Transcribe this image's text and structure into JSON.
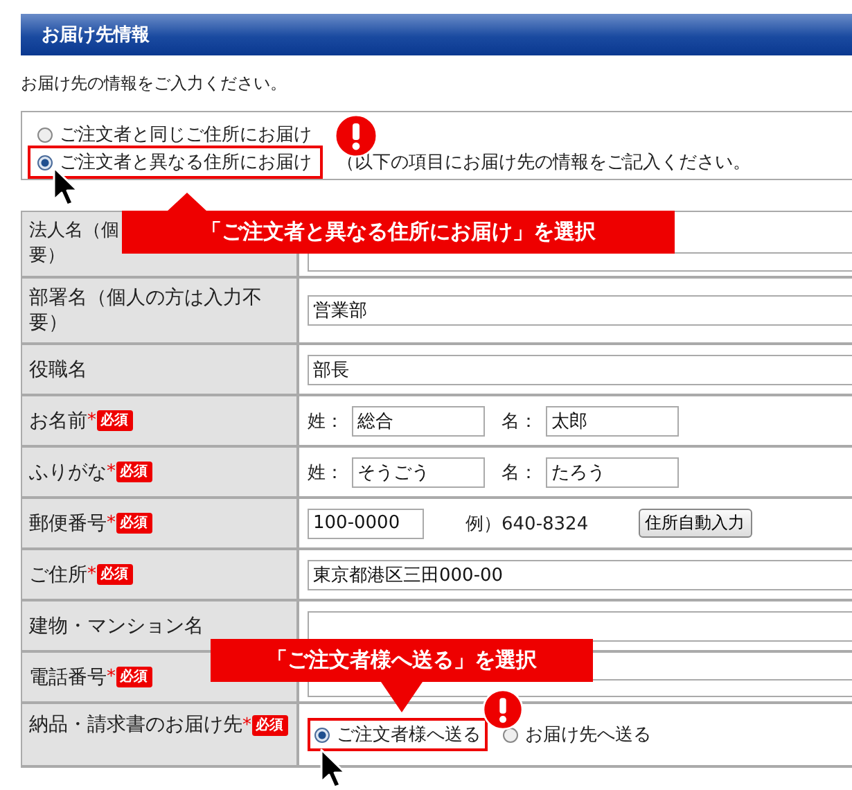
{
  "section": {
    "title": "お届け先情報"
  },
  "intro": "お届け先の情報をご入力ください。",
  "destination_options": [
    {
      "label": "ご注文者と同じご住所にお届け",
      "selected": false,
      "highlighted": false
    },
    {
      "label": "ご注文者と異なる住所にお届け",
      "selected": true,
      "highlighted": true
    }
  ],
  "option_note": "（以下の項目にお届け先の情報をご記入ください。",
  "form_rows": [
    {
      "kind": "text",
      "label": "法人名（個",
      "label_continued": "要）"
    },
    {
      "kind": "text",
      "label": "部署名（個人の方は入力不要）",
      "value": "営業部"
    },
    {
      "kind": "text",
      "label": "役職名",
      "value": "部長"
    },
    {
      "kind": "pair",
      "label": "お名前",
      "asterisk": "*",
      "badge": "必須",
      "fields": [
        {
          "prefix": "姓：",
          "value": "総合"
        },
        {
          "prefix": "名：",
          "value": "太郎"
        }
      ]
    },
    {
      "kind": "pair",
      "label": "ふりがな",
      "asterisk": "*",
      "badge": "必須",
      "fields": [
        {
          "prefix": "姓：",
          "value": "そうごう"
        },
        {
          "prefix": "名：",
          "value": "たろう"
        }
      ]
    },
    {
      "kind": "postal",
      "label": "郵便番号",
      "asterisk": "*",
      "badge": "必須",
      "value": "100-0000",
      "example": "例）640-8324",
      "button": "住所自動入力"
    },
    {
      "kind": "text",
      "label": "ご住所",
      "asterisk": "*",
      "badge": "必須",
      "value": "東京都港区三田000-00"
    },
    {
      "kind": "text",
      "label": "建物・マンション名"
    },
    {
      "kind": "text",
      "label": "電話番号",
      "asterisk": "*",
      "badge": "必須"
    },
    {
      "kind": "radio",
      "label": "納品・請求書のお届け先",
      "asterisk": "*",
      "badge": "必須",
      "options": [
        {
          "label": "ご注文者様へ送る",
          "selected": true,
          "highlighted": true
        },
        {
          "label": "お届け先へ送る",
          "selected": false,
          "highlighted": false
        }
      ]
    }
  ],
  "callouts": [
    "「ご注文者と異なる住所にお届け」を選択",
    "「ご注文者様へ送る」を選択"
  ]
}
